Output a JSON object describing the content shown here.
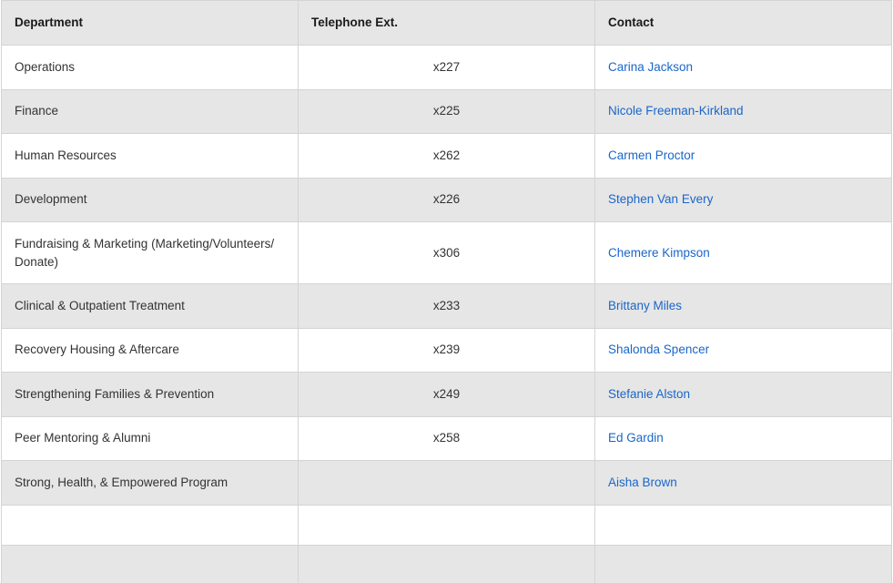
{
  "table": {
    "headers": [
      "Department",
      "Telephone Ext.",
      "Contact"
    ],
    "rows": [
      {
        "department": "Operations",
        "ext": "x227",
        "contact": "Carina Jackson"
      },
      {
        "department": "Finance",
        "ext": "x225",
        "contact": "Nicole Freeman-Kirkland"
      },
      {
        "department": "Human Resources",
        "ext": "x262",
        "contact": "Carmen Proctor"
      },
      {
        "department": "Development",
        "ext": "x226",
        "contact": "Stephen Van Every"
      },
      {
        "department": "Fundraising & Marketing (Marketing/Volunteers/ Donate)",
        "ext": "x306",
        "contact": "Chemere Kimpson"
      },
      {
        "department": "Clinical & Outpatient Treatment",
        "ext": "x233",
        "contact": "Brittany Miles"
      },
      {
        "department": "Recovery Housing & Aftercare",
        "ext": "x239",
        "contact": "Shalonda Spencer"
      },
      {
        "department": "Strengthening Families & Prevention",
        "ext": "x249",
        "contact": "Stefanie Alston"
      },
      {
        "department": "Peer Mentoring & Alumni",
        "ext": "x258",
        "contact": "Ed Gardin"
      },
      {
        "department": "Strong, Health, & Empowered Program",
        "ext": "",
        "contact": "Aisha Brown"
      },
      {
        "department": "",
        "ext": "",
        "contact": ""
      },
      {
        "department": "",
        "ext": "",
        "contact": ""
      }
    ]
  },
  "colors": {
    "link": "#1a66c9",
    "header_bg": "#e6e6e6",
    "stripe_bg": "#e6e6e6",
    "border": "#d4d4d4"
  }
}
